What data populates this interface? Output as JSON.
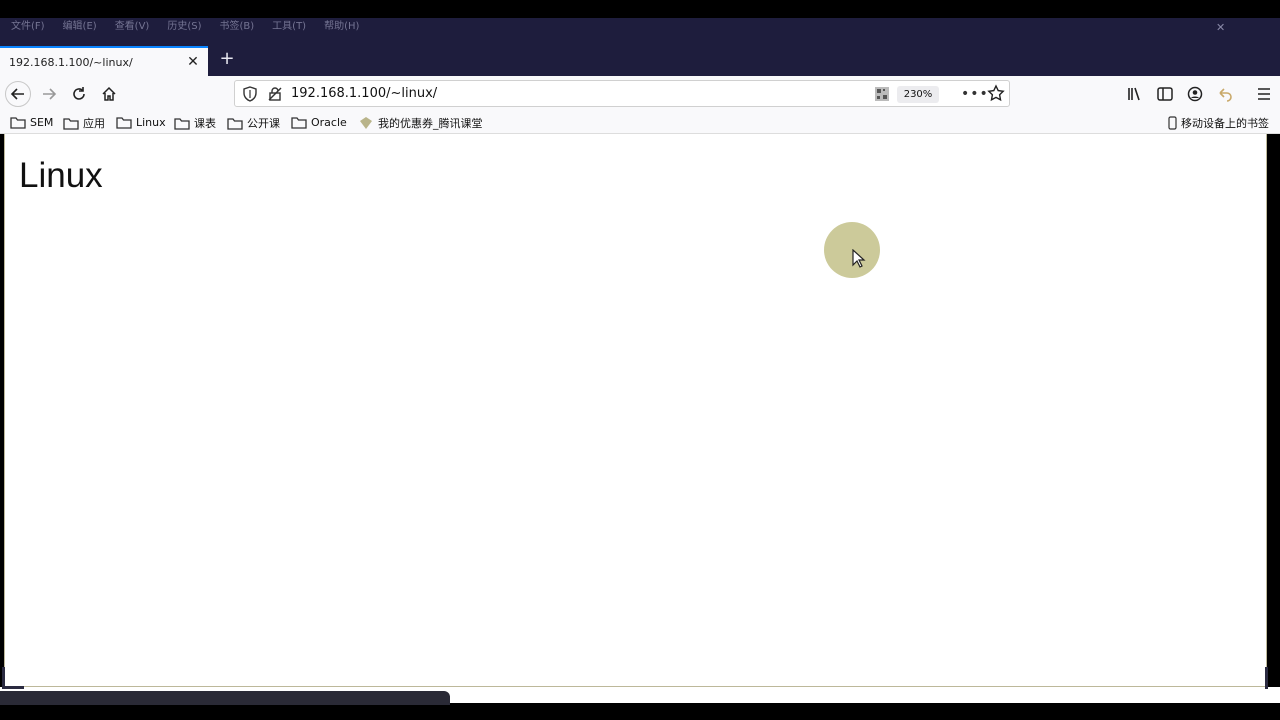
{
  "menubar": {
    "items": [
      "文件(F)",
      "编辑(E)",
      "查看(V)",
      "历史(S)",
      "书签(B)",
      "工具(T)",
      "帮助(H)"
    ]
  },
  "tab": {
    "title": "192.168.1.100/~linux/",
    "close_icon": "close-icon",
    "new_tab_label": "+"
  },
  "navbar": {
    "back_icon": "back-arrow-icon",
    "forward_icon": "forward-arrow-icon",
    "reload_icon": "reload-icon",
    "home_icon": "home-icon"
  },
  "urlbar": {
    "url": "192.168.1.100/~linux/",
    "zoom": "230%",
    "more": "•••"
  },
  "bookmarks": {
    "items": [
      {
        "label": "SEM",
        "icon": "folder-icon"
      },
      {
        "label": "应用",
        "icon": "folder-icon"
      },
      {
        "label": "Linux",
        "icon": "folder-icon"
      },
      {
        "label": "课表",
        "icon": "folder-icon"
      },
      {
        "label": "公开课",
        "icon": "folder-icon"
      },
      {
        "label": "Oracle",
        "icon": "folder-icon"
      },
      {
        "label": "我的优惠券_腾讯课堂",
        "icon": "tencent-class-icon"
      }
    ],
    "mobile": "移动设备上的书签"
  },
  "page": {
    "heading": "Linux"
  },
  "colors": {
    "titlebar": "#1e1d3d",
    "toolbar": "#f9f9fb",
    "accent": "#0a84ff",
    "cursor_halo": "#c9c795"
  }
}
